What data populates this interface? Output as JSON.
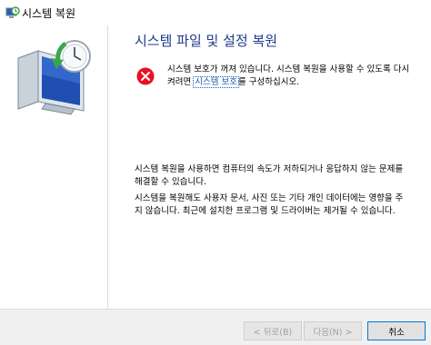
{
  "window": {
    "title": "시스템 복원"
  },
  "main": {
    "heading": "시스템 파일 및 설정 복원",
    "error_text_before": "시스템 보호가 꺼져 있습니다. 시스템 복원을 사용할 수 있도록 다시 켜려면 ",
    "error_link": "시스템 보호",
    "error_text_after": "를 구성하십시오.",
    "paragraph1": "시스템 복원을 사용하면 컴퓨터의 속도가 저하되거나 응답하지 않는 문제를 해결할 수 있습니다.",
    "paragraph2": "시스템을 복원해도 사용자 문서, 사진 또는 기타 개인 데이터에는 영향을 주지 않습니다. 최근에 설치한 프로그램 및 드라이버는 제거될 수 있습니다."
  },
  "footer": {
    "back_label": "< 뒤로(B)",
    "next_label": "다음(N) >",
    "cancel_label": "취소"
  },
  "colors": {
    "heading": "#1e3a8a",
    "link": "#1a5fb4",
    "error_red": "#e81123"
  }
}
